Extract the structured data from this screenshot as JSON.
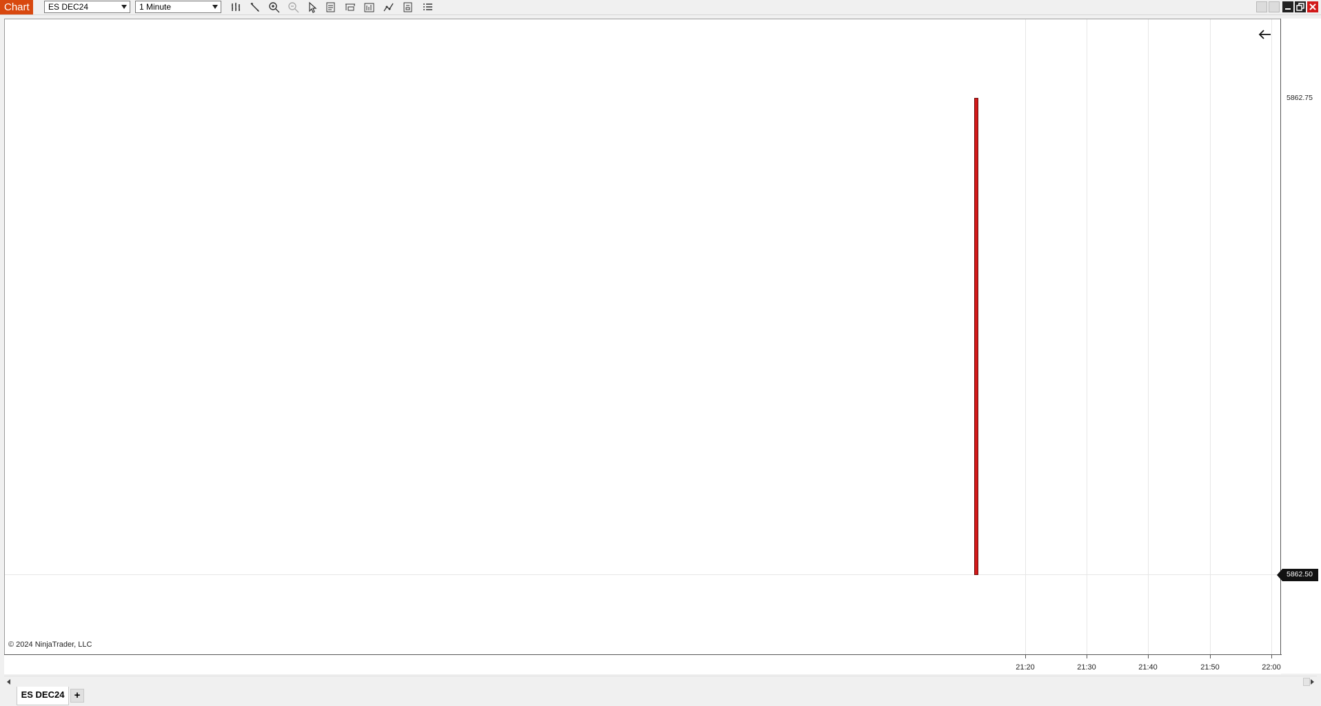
{
  "app": {
    "title": "Chart"
  },
  "toolbar": {
    "instrument": "ES DEC24",
    "interval": "1 Minute",
    "tools": [
      "bar-chart-icon",
      "pencil-icon",
      "zoom-in-icon",
      "zoom-out-icon",
      "pointer-icon",
      "properties-icon",
      "templates-icon",
      "data-box-icon",
      "indicators-icon",
      "strategies-icon",
      "list-icon"
    ]
  },
  "chart": {
    "price_labels": [
      "5862.75",
      "5862.50"
    ],
    "current_price": "5862.50",
    "time_labels": [
      "21:20",
      "21:30",
      "21:40",
      "21:50",
      "22:00"
    ],
    "copyright": "© 2024 NinjaTrader, LLC"
  },
  "chart_data": {
    "type": "bar",
    "bars": [
      {
        "time": "21:15",
        "open": 5862.75,
        "high": 5862.75,
        "low": 5862.5,
        "close": 5862.5
      }
    ],
    "x_ticks": [
      "21:20",
      "21:30",
      "21:40",
      "21:50",
      "22:00"
    ],
    "y_ticks": [
      5862.5,
      5862.75
    ],
    "colors": {
      "down": "#d21a1a",
      "outline": "#6b0a0a"
    }
  },
  "tabs": [
    {
      "label": "ES DEC24"
    }
  ],
  "colors": {
    "accent": "#d8480f"
  }
}
